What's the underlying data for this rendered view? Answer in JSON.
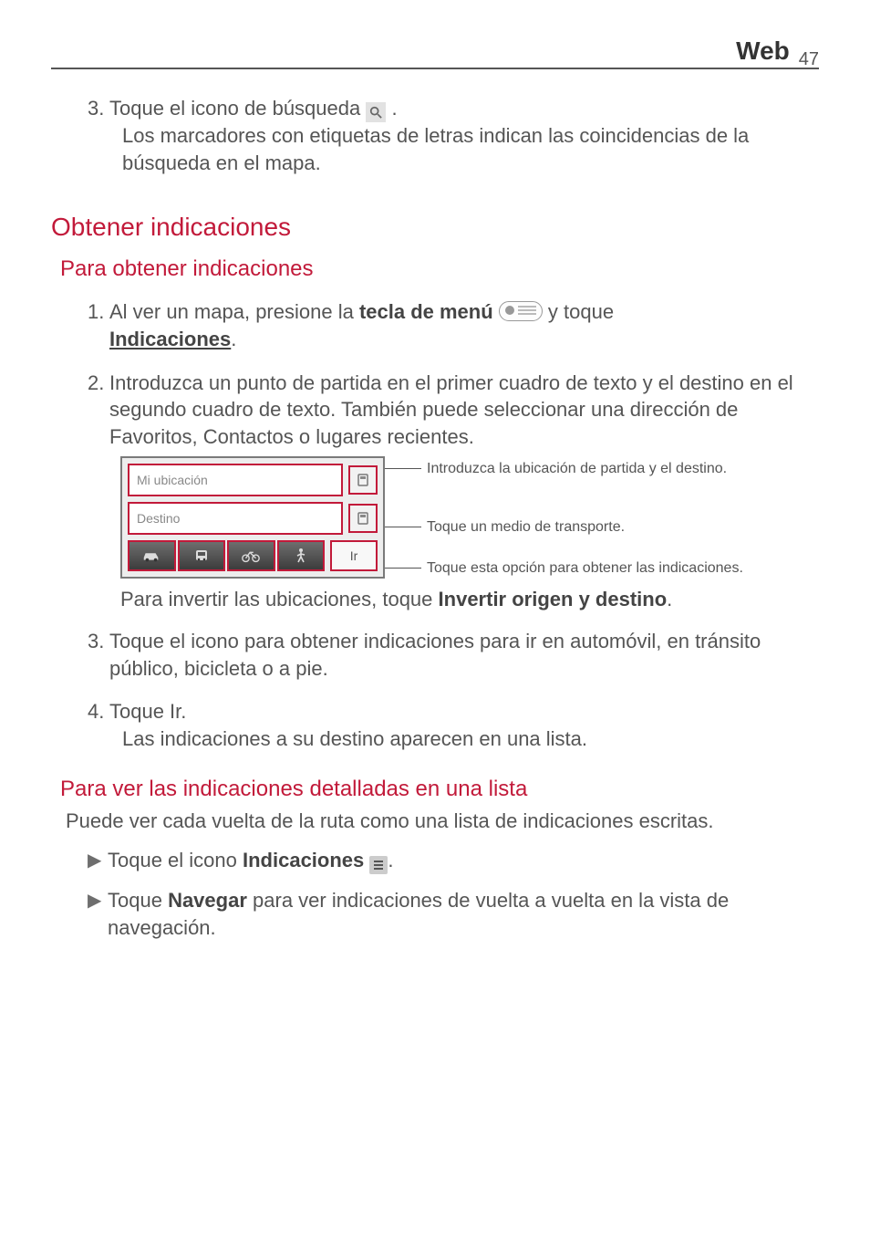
{
  "header": {
    "title": "Web",
    "page_number": "47"
  },
  "step3_intro": {
    "num": "3.",
    "line1a": "Toque el icono de búsqueda ",
    "line1b": ".",
    "line2": "Los marcadores con etiquetas de letras indican las coincidencias de la búsqueda en el mapa."
  },
  "section1": {
    "title": "Obtener indicaciones"
  },
  "sub1": {
    "title": "Para obtener indicaciones"
  },
  "s1_step1": {
    "num": "1.",
    "a": "Al ver un mapa, presione la ",
    "b": "tecla de menú ",
    "c": " y toque ",
    "d": "Indicaciones",
    "e": "."
  },
  "s1_step2": {
    "num": "2.",
    "text": "Introduzca un punto de partida en el primer cuadro de texto y el destino en el segundo cuadro de texto. También puede seleccionar una dirección de Favoritos, Contactos o lugares recientes."
  },
  "widget": {
    "input1": "Mi ubicación",
    "input2": "Destino",
    "go": "Ir",
    "callout1": "Introduzca la ubicación de partida y el destino.",
    "callout2": "Toque un medio de transporte.",
    "callout3": "Toque esta opción para obtener las indicaciones."
  },
  "post_widget": {
    "a": "Para invertir las ubicaciones, toque ",
    "b": "Invertir origen y destino",
    "c": "."
  },
  "s1_step3": {
    "num": "3.",
    "text": "Toque el icono para obtener indicaciones para ir en automóvil, en tránsito público, bicicleta o a pie."
  },
  "s1_step4": {
    "num": "4.",
    "line1": "Toque Ir.",
    "line2": "Las indicaciones a su destino aparecen en una lista."
  },
  "sub2": {
    "title": "Para ver las indicaciones detalladas en una lista"
  },
  "sub2_intro": "Puede ver cada vuelta de la ruta como una lista de indicaciones escritas.",
  "bullet1": {
    "a": "Toque el icono ",
    "b": "Indicaciones ",
    "c": "."
  },
  "bullet2": {
    "a": "Toque ",
    "b": "Navegar",
    "c": " para ver indicaciones de vuelta a vuelta en la vista de navegación."
  }
}
